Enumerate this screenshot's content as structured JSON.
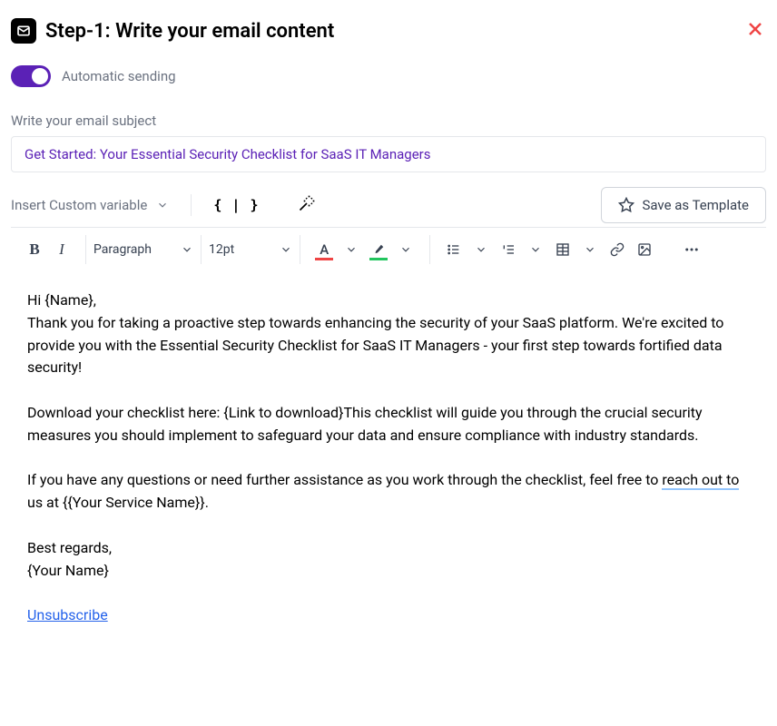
{
  "header": {
    "title": "Step-1:  Write your email content"
  },
  "automatic_sending_label": "Automatic sending",
  "subject": {
    "label": "Write your email subject",
    "value": "Get Started: Your Essential Security Checklist for SaaS IT Managers"
  },
  "toolbar_top": {
    "insert_variable": "Insert Custom variable",
    "save_template": "Save as Template"
  },
  "format": {
    "paragraph": "Paragraph",
    "font_size": "12pt"
  },
  "body": {
    "greeting": "Hi {Name},",
    "p1": "Thank you for taking a proactive step towards enhancing the security of your SaaS platform. We're excited to provide you with the Essential Security Checklist for SaaS IT Managers - your first step towards fortified data security!",
    "p2a": "Download your checklist here: {Link to download}This checklist will guide you through the crucial security measures you should implement to safeguard your data and ensure compliance with industry standards.",
    "p3_before": "If you have any questions or need further assistance as you work through the checklist, feel free to ",
    "p3_underline": "reach out to",
    "p3_after": " us at {{Your Service Name}}.",
    "closing1": "Best regards,",
    "closing2": "{Your Name}",
    "unsubscribe": "Unsubscribe"
  }
}
